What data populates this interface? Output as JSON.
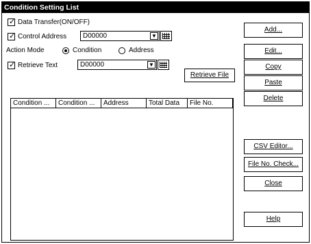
{
  "window": {
    "title": "Condition Setting List"
  },
  "options": {
    "data_transfer": {
      "label": "Data Transfer(ON/OFF)",
      "checked": true
    },
    "control_address": {
      "label": "Control Address",
      "checked": true,
      "value": "D00000"
    },
    "action_mode": {
      "label": "Action Mode",
      "options": [
        "Condition",
        "Address"
      ],
      "selected": "Condition"
    },
    "retrieve_text": {
      "label": "Retrieve Text",
      "checked": true,
      "value": "D00000"
    },
    "retrieve_file_label": "Retrieve File"
  },
  "list": {
    "columns": [
      "Condition ...",
      "Condition ...",
      "Address",
      "Total Data",
      "File No."
    ]
  },
  "buttons": {
    "add": "Add...",
    "edit": "Edit...",
    "copy": "Copy",
    "paste": "Paste",
    "delete": "Delete",
    "csv_editor": "CSV Editor...",
    "file_no_check": "File No. Check...",
    "close": "Close",
    "help": "Help"
  },
  "icons": {
    "check": "check-icon",
    "dropdown": "chevron-down-icon",
    "keypad": "keypad-icon"
  }
}
